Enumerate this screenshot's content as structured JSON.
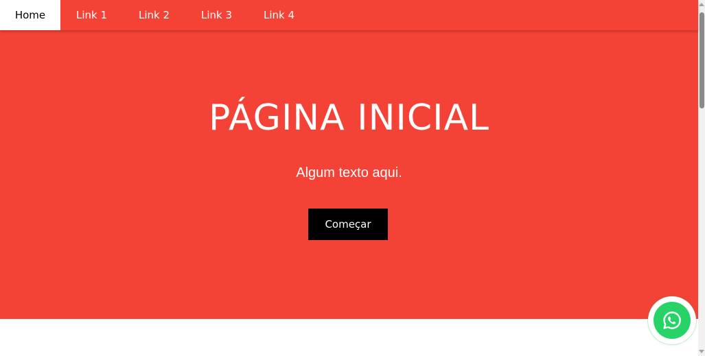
{
  "nav": {
    "items": [
      {
        "label": "Home",
        "active": true
      },
      {
        "label": "Link 1"
      },
      {
        "label": "Link 2"
      },
      {
        "label": "Link 3"
      },
      {
        "label": "Link 4"
      }
    ]
  },
  "hero": {
    "title": "PÁGINA INICIAL",
    "subtitle": "Algum texto aqui.",
    "button_label": "Começar"
  },
  "floating": {
    "icon": "whatsapp-icon"
  },
  "colors": {
    "primary": "#f44336",
    "button": "#000000",
    "whatsapp": "#25d366"
  }
}
